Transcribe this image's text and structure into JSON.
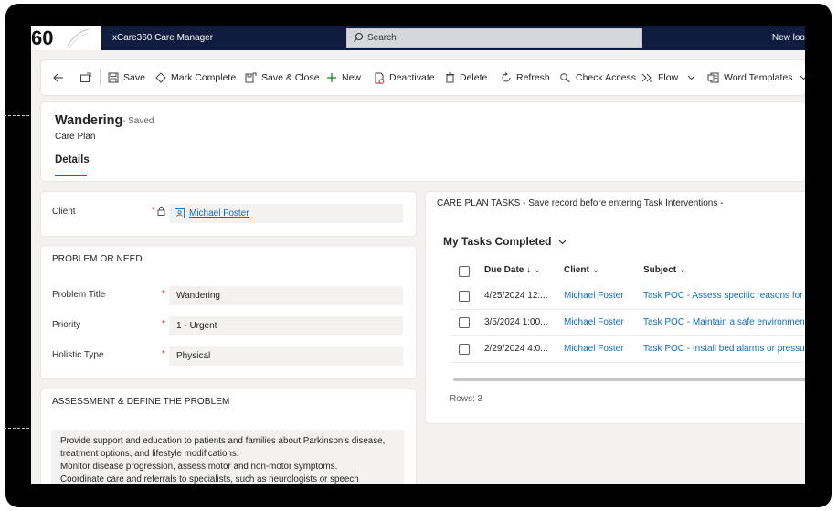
{
  "topbar": {
    "logo_text": "60",
    "app_title": "xCare360 Care Manager",
    "search_placeholder": "Search",
    "new_look": "New loo"
  },
  "commands": [
    {
      "label": "Save",
      "icon": "save-icon"
    },
    {
      "label": "Mark Complete",
      "icon": "mark-complete-icon"
    },
    {
      "label": "Save & Close",
      "icon": "save-close-icon"
    },
    {
      "label": "New",
      "icon": "plus-icon"
    },
    {
      "label": "Deactivate",
      "icon": "deactivate-icon"
    },
    {
      "label": "Delete",
      "icon": "delete-icon"
    },
    {
      "label": "Refresh",
      "icon": "refresh-icon"
    },
    {
      "label": "Check Access",
      "icon": "check-access-icon"
    },
    {
      "label": "Flow",
      "icon": "flow-icon"
    },
    {
      "label": "Word Templates",
      "icon": "word-templates-icon"
    }
  ],
  "record": {
    "title": "Wandering",
    "status": "- Saved",
    "entity": "Care Plan",
    "tab": "Details"
  },
  "client_section": {
    "label": "Client",
    "required": "*",
    "value": "Michael Foster"
  },
  "problem_section": {
    "title": "PROBLEM OR NEED",
    "fields": [
      {
        "label": "Problem Title",
        "required": "*",
        "value": "Wandering"
      },
      {
        "label": "Priority",
        "required": "*",
        "value": "1 - Urgent"
      },
      {
        "label": "Holistic Type",
        "required": "*",
        "value": "Physical"
      }
    ]
  },
  "assessment_section": {
    "title": "ASSESSMENT & DEFINE THE PROBLEM",
    "lines": [
      "Provide support and education to patients and families about Parkinson's disease,",
      "treatment options, and lifestyle modifications.",
      "Monitor disease progression, assess motor and non-motor symptoms.",
      "Coordinate care and referrals to specialists, such as neurologists or speech therapists."
    ]
  },
  "tasks": {
    "title": "CARE PLAN TASKS - Save record before entering Task Interventions -",
    "view_name": "My Tasks Completed",
    "columns": [
      "Due Date",
      "Client",
      "Subject"
    ],
    "rows": [
      {
        "due": "4/25/2024 12:...",
        "client": "Michael Foster",
        "subject": "Task POC - Assess specific reasons for wa"
      },
      {
        "due": "3/5/2024 1:00...",
        "client": "Michael Foster",
        "subject": "Task POC - Maintain a safe environment a"
      },
      {
        "due": "2/29/2024 4:0...",
        "client": "Michael Foster",
        "subject": "Task POC - Install bed alarms or pressure"
      }
    ],
    "rows_count": "Rows: 3"
  },
  "colors": {
    "topbar": "#0f1c3f",
    "link": "#0f6cbd",
    "required": "#c50f1f"
  }
}
